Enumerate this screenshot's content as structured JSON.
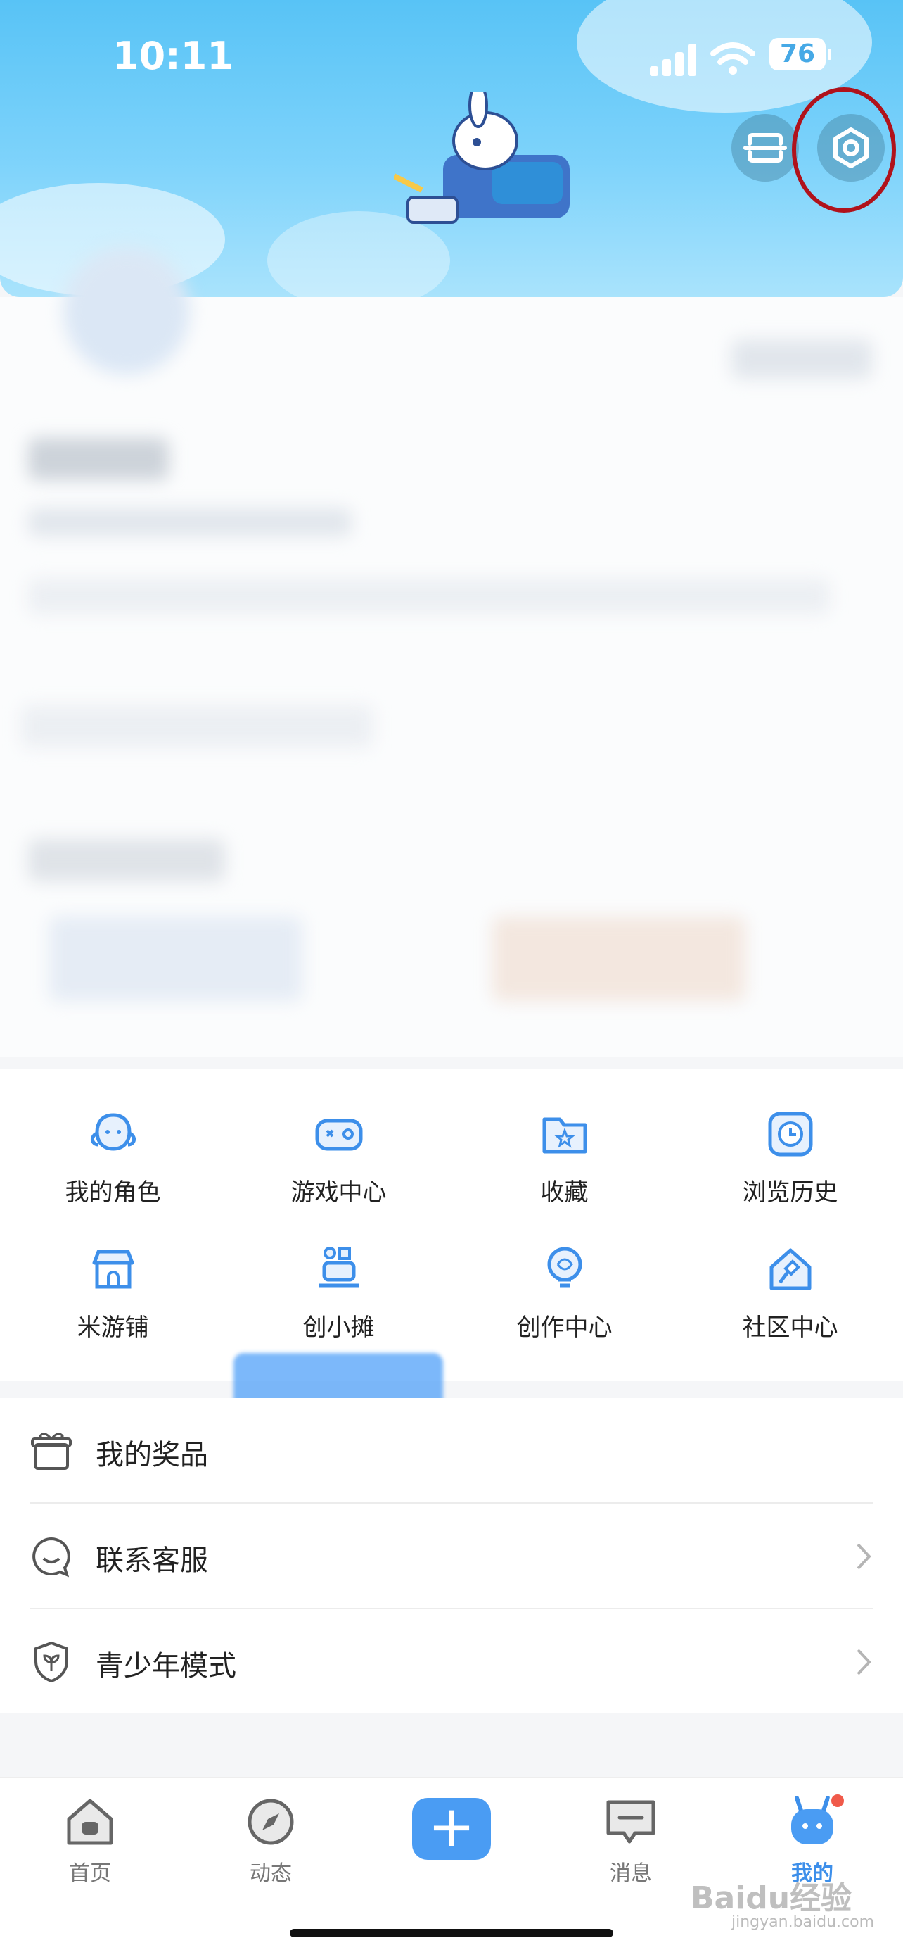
{
  "status_bar": {
    "time": "10:11",
    "battery": "76"
  },
  "header": {
    "scan_icon": "scan-icon",
    "settings_icon": "hexagon-settings-icon"
  },
  "grid": {
    "row1": [
      {
        "label": "我的角色",
        "icon": "character-icon"
      },
      {
        "label": "游戏中心",
        "icon": "gamepad-icon"
      },
      {
        "label": "收藏",
        "icon": "folder-star-icon"
      },
      {
        "label": "浏览历史",
        "icon": "clock-icon"
      }
    ],
    "row2": [
      {
        "label": "米游铺",
        "icon": "shop-icon"
      },
      {
        "label": "创小摊",
        "icon": "stall-icon"
      },
      {
        "label": "创作中心",
        "icon": "creation-bulb-icon"
      },
      {
        "label": "社区中心",
        "icon": "community-hammer-icon"
      }
    ]
  },
  "list": {
    "prizes": "我的奖品",
    "service": "联系客服",
    "youth_mode": "青少年模式"
  },
  "bottom_nav": {
    "home": "首页",
    "feed": "动态",
    "plus": "+",
    "messages": "消息",
    "me": "我的"
  },
  "watermark": {
    "main": "Baidu经验",
    "sub": "jingyan.baidu.com"
  },
  "colors": {
    "accent": "#4a9cf3",
    "highlight_ring": "#b0121b",
    "badge": "#f05a4a"
  }
}
